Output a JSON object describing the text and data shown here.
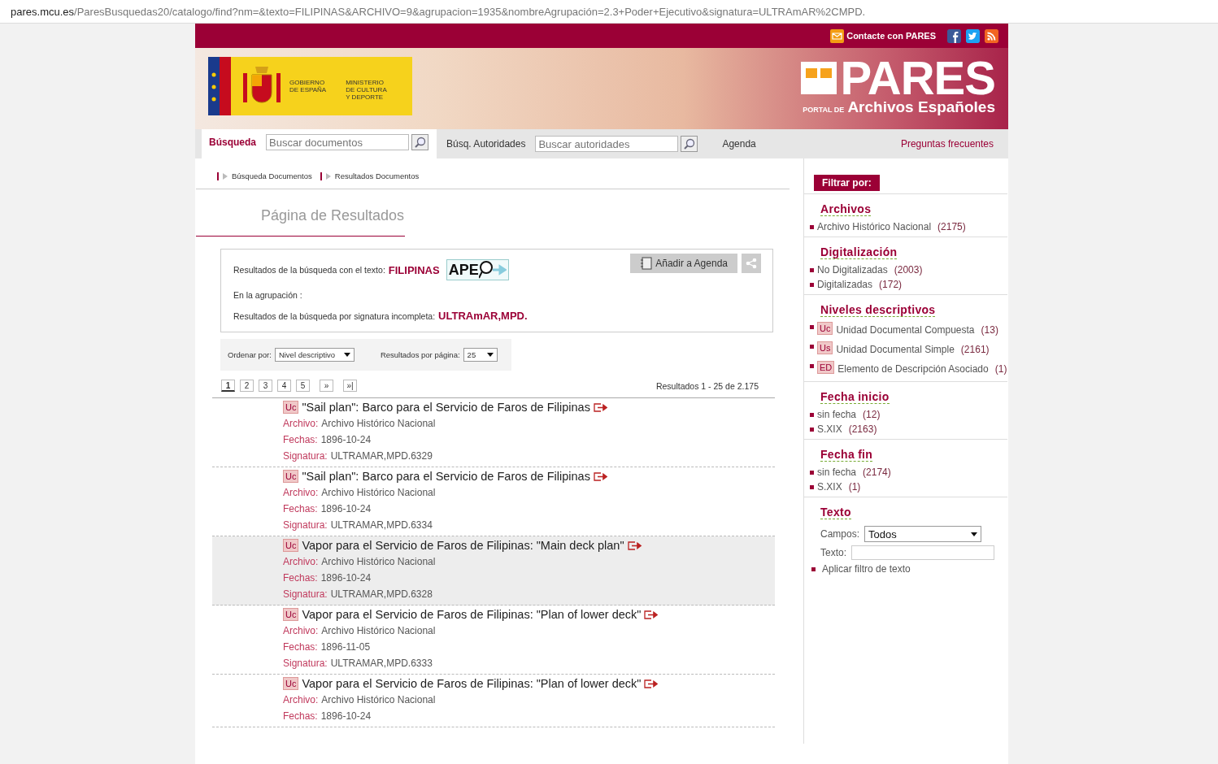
{
  "address_bar": {
    "url_host": "pares.mcu.es",
    "url_path": "/ParesBusquedas20/catalogo/find?nm=&texto=FILIPINAS&ARCHIVO=9&agrupacion=1935&nombreAgrupación=2.3+Poder+Ejecutivo&signatura=ULTRAmAR%2CMPD."
  },
  "top_bar": {
    "contact": "Contacte con PARES"
  },
  "banner": {
    "gov_text": "GOBIERNO\nDE ESPAÑA",
    "ministry_text": "MINISTERIO\nDE CULTURA\nY DEPORTE",
    "logo_title": "PARES",
    "logo_prefix": "PORTAL DE",
    "logo_subtitle": "Archivos Españoles"
  },
  "nav": {
    "search_tab": "Búsqueda",
    "search_placeholder": "Buscar documentos",
    "authorities_tab": "Búsq. Autoridades",
    "authorities_placeholder": "Buscar autoridades",
    "agenda": "Agenda",
    "faq": "Preguntas frecuentes"
  },
  "breadcrumbs": [
    "Búsqueda Documentos",
    "Resultados Documentos"
  ],
  "page_title": "Página de Resultados",
  "summary": {
    "text_label": "Resultados de la búsqueda con el texto:",
    "text_value": "FILIPINAS",
    "ape_logo": "APE",
    "group_label": "En la agrupación :",
    "signature_label": "Resultados de la búsqueda por signatura incompleta:",
    "signature_value": "ULTRAmAR,MPD.",
    "add_agenda": "Añadir a Agenda"
  },
  "sort": {
    "label": "Ordenar por:",
    "value": "Nivel descriptivo",
    "per_page_label": "Resultados por página:",
    "per_page_value": "25"
  },
  "pagination": {
    "pages": [
      {
        "label": "1",
        "selected": true
      },
      {
        "label": "2",
        "selected": false
      },
      {
        "label": "3",
        "selected": false
      },
      {
        "label": "4",
        "selected": false
      },
      {
        "label": "5",
        "selected": false
      },
      {
        "label": "»",
        "selected": false
      },
      {
        "label": "»|",
        "selected": false
      }
    ],
    "count": "Resultados 1 - 25 de 2.175"
  },
  "results": [
    {
      "badge": "Uc",
      "title": "\"Sail plan\": Barco para el Servicio de Faros de Filipinas",
      "selected": false,
      "fields": [
        {
          "label": "Archivo:",
          "value": "Archivo Histórico Nacional"
        },
        {
          "label": "Fechas:",
          "value": "1896-10-24"
        },
        {
          "label": "Signatura:",
          "value": "ULTRAMAR,MPD.6329"
        }
      ]
    },
    {
      "badge": "Uc",
      "title": "\"Sail plan\": Barco para el Servicio de Faros de Filipinas",
      "selected": false,
      "fields": [
        {
          "label": "Archivo:",
          "value": "Archivo Histórico Nacional"
        },
        {
          "label": "Fechas:",
          "value": "1896-10-24"
        },
        {
          "label": "Signatura:",
          "value": "ULTRAMAR,MPD.6334"
        }
      ]
    },
    {
      "badge": "Uc",
      "title": "Vapor para el Servicio de Faros de Filipinas: \"Main deck plan\"",
      "selected": true,
      "fields": [
        {
          "label": "Archivo:",
          "value": "Archivo Histórico Nacional"
        },
        {
          "label": "Fechas:",
          "value": "1896-10-24"
        },
        {
          "label": "Signatura:",
          "value": "ULTRAMAR,MPD.6328"
        }
      ]
    },
    {
      "badge": "Uc",
      "title": "Vapor para el Servicio de Faros de Filipinas: \"Plan of lower deck\"",
      "selected": false,
      "fields": [
        {
          "label": "Archivo:",
          "value": "Archivo Histórico Nacional"
        },
        {
          "label": "Fechas:",
          "value": "1896-11-05"
        },
        {
          "label": "Signatura:",
          "value": "ULTRAMAR,MPD.6333"
        }
      ]
    },
    {
      "badge": "Uc",
      "title": "Vapor para el Servicio de Faros de Filipinas: \"Plan of lower deck\"",
      "selected": false,
      "fields": [
        {
          "label": "Archivo:",
          "value": "Archivo Histórico Nacional"
        },
        {
          "label": "Fechas:",
          "value": "1896-10-24"
        }
      ]
    }
  ],
  "filters": {
    "title": "Filtrar por:",
    "sections": [
      {
        "kind": "list",
        "heading": "Archivos",
        "items": [
          {
            "label": "Archivo Histórico Nacional",
            "count": "(2175)"
          }
        ]
      },
      {
        "kind": "list",
        "heading": "Digitalización",
        "items": [
          {
            "label": "No Digitalizadas",
            "count": "(2003)"
          },
          {
            "label": "Digitalizadas",
            "count": "(172)"
          }
        ]
      },
      {
        "kind": "list",
        "heading": "Niveles descriptivos",
        "items": [
          {
            "badge": "Uc",
            "label": "Unidad Documental Compuesta",
            "count": "(13)"
          },
          {
            "badge": "Us",
            "label": "Unidad Documental Simple",
            "count": "(2161)"
          },
          {
            "badge": "ED",
            "label": "Elemento de Descripción Asociado",
            "count": "(1)"
          }
        ]
      },
      {
        "kind": "list",
        "heading": "Fecha inicio",
        "items": [
          {
            "label": "sin fecha",
            "count": "(12)"
          },
          {
            "label": "S.XIX",
            "count": "(2163)"
          }
        ]
      },
      {
        "kind": "list",
        "heading": "Fecha fin",
        "items": [
          {
            "label": "sin fecha",
            "count": "(2174)"
          },
          {
            "label": "S.XIX",
            "count": "(1)"
          }
        ]
      },
      {
        "kind": "text",
        "heading": "Texto",
        "fields_label": "Campos:",
        "fields_value": "Todos",
        "text_label": "Texto:",
        "apply": "Aplicar filtro de texto"
      }
    ]
  }
}
